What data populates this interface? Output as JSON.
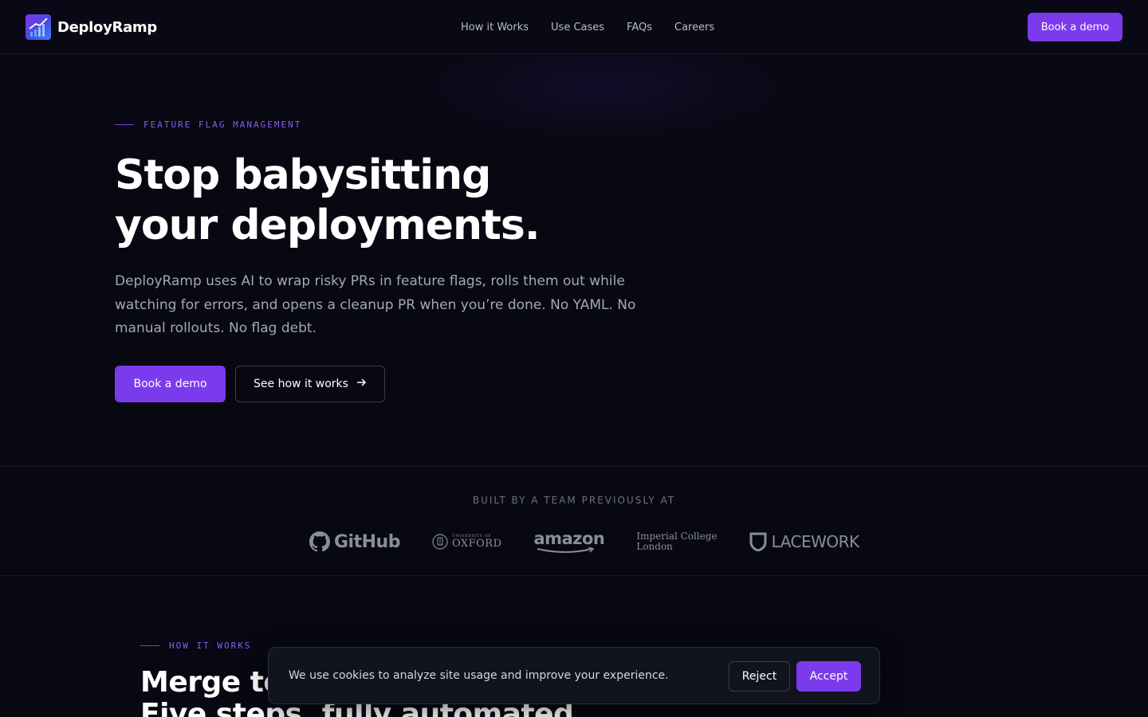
{
  "nav": {
    "brand": "DeployRamp",
    "links": [
      "How it Works",
      "Use Cases",
      "FAQs",
      "Careers"
    ],
    "cta": "Book a demo"
  },
  "hero": {
    "eyebrow": "FEATURE FLAG MANAGEMENT",
    "title_line1": "Stop babysitting",
    "title_line2": "your deployments.",
    "subtitle": "DeployRamp uses AI to wrap risky PRs in feature flags, rolls them out while watching for errors, and opens a cleanup PR when you’re done. No YAML. No manual rollouts. No flag debt.",
    "primary_cta": "Book a demo",
    "secondary_cta": "See how it works",
    "secondary_cta_icon": "arrow-right-icon"
  },
  "logos": {
    "label": "BUILT BY A TEAM PREVIOUSLY AT",
    "github": "GitHub",
    "oxford_small": "UNIVERSITY OF",
    "oxford_big": "OXFORD",
    "amazon": "amazon",
    "imperial_line1": "Imperial College",
    "imperial_line2": "London",
    "lacework": "LACEWORK"
  },
  "how": {
    "eyebrow": "HOW IT WORKS",
    "title_line1": "Merge to",
    "title_line2": "Five steps, fully automated."
  },
  "cookie": {
    "text": "We use cookies to analyze site usage and improve your experience.",
    "reject": "Reject",
    "accept": "Accept"
  },
  "colors": {
    "background": "#070812",
    "accent": "#7c3aed",
    "muted_text": "#a4a7b8"
  }
}
